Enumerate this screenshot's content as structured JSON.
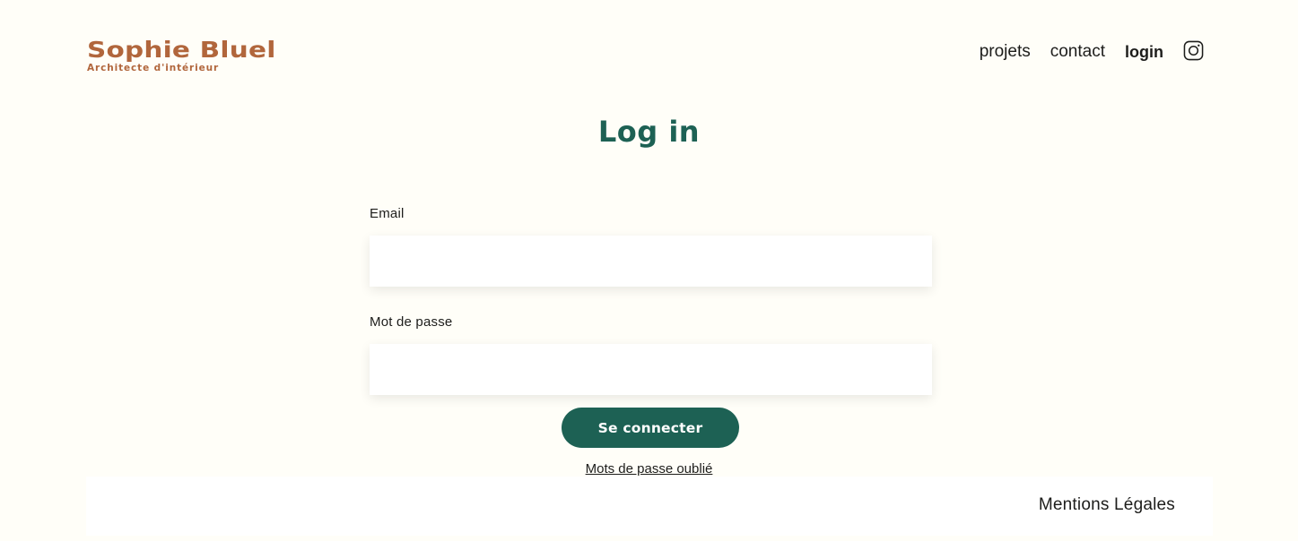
{
  "header": {
    "logo_title": "Sophie Bluel",
    "logo_subtitle": "Architecte d'intérieur",
    "nav": {
      "projects": "projets",
      "contact": "contact",
      "login": "login",
      "instagram_icon": "instagram-icon"
    }
  },
  "main": {
    "title": "Log in",
    "form": {
      "email_label": "Email",
      "email_value": "",
      "password_label": "Mot de passe",
      "password_value": "",
      "submit_label": "Se connecter",
      "forgot_label": "Mots de passe oublié"
    }
  },
  "footer": {
    "legal_label": "Mentions Légales"
  },
  "colors": {
    "background": "#FFFEF8",
    "brand": "#B1663C",
    "accent": "#1D6154",
    "text": "#1D1D1B"
  }
}
